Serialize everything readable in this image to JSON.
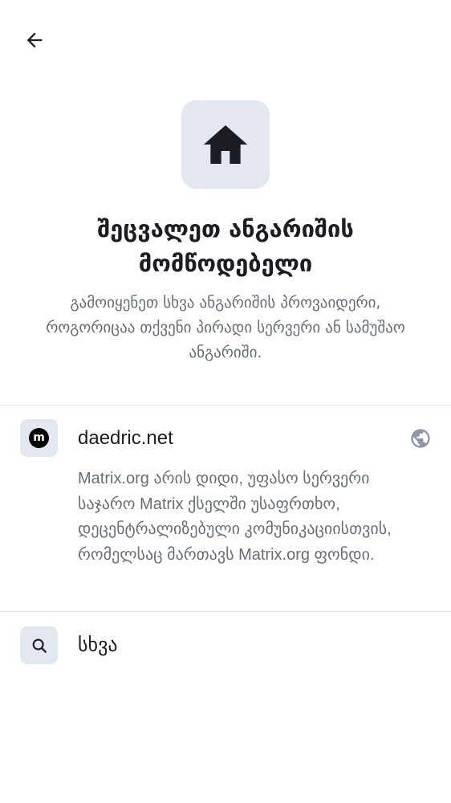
{
  "header": {
    "back_icon": "arrow-left-icon"
  },
  "hero": {
    "icon": "home-icon",
    "title": "შეცვალეთ ანგარიშის მომწოდებელი",
    "subtitle": "გამოიყენეთ სხვა ანგარიშის პროვაიდერი, როგორიცაა თქვენი პირადი სერვერი ან სამუშაო ანგარიში."
  },
  "options": [
    {
      "icon": "matrix-logo-icon",
      "icon_text": "m",
      "label": "daedric.net",
      "trailing_icon": "globe-icon",
      "description": "Matrix.org არის დიდი, უფასო სერვერი საჯარო Matrix ქსელში უსაფრთხო, დეცენტრალიზებული კომუნიკაციისთვის, რომელსაც მართავს Matrix.org ფონდი."
    },
    {
      "icon": "search-icon",
      "label": "სხვა"
    }
  ],
  "colors": {
    "background": "#ffffff",
    "text_primary": "#1b1d22",
    "text_secondary": "#656d77",
    "icon_bg": "#e3e7ef",
    "divider": "#e1e5eb",
    "globe": "#8f97a3"
  }
}
